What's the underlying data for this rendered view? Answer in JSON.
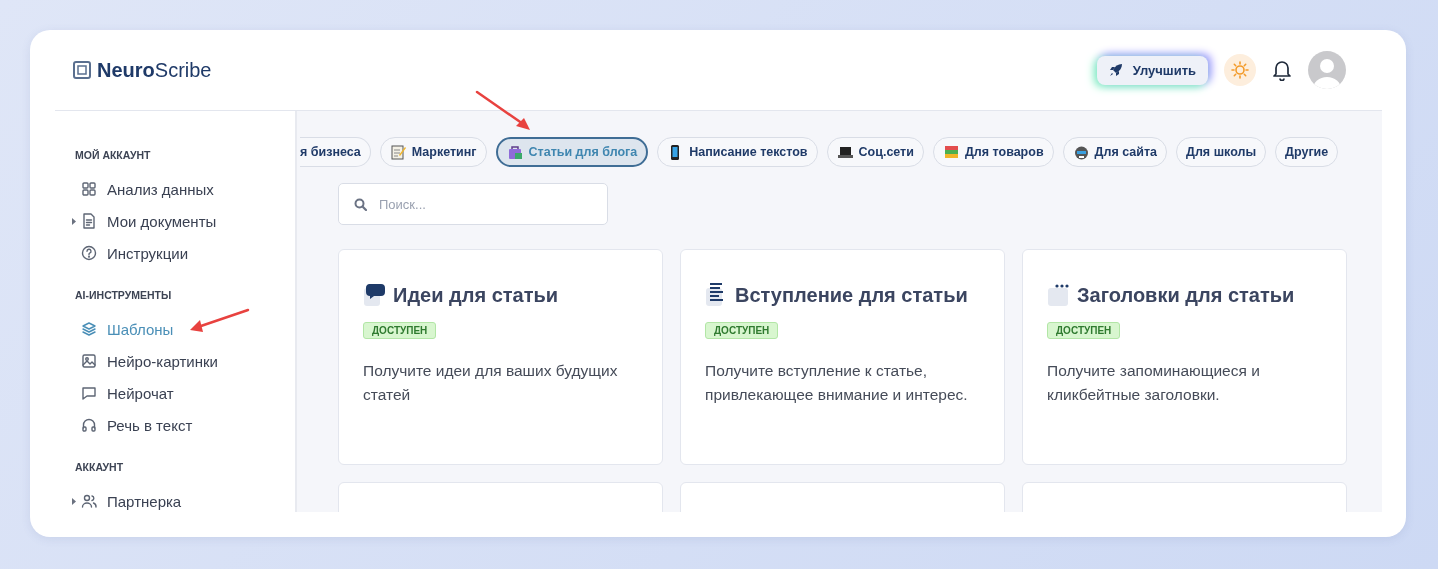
{
  "logo": {
    "text": "**Neuro**Scribe"
  },
  "header": {
    "upgrade_button": "Улучшить"
  },
  "sidebar": {
    "sections": [
      {
        "title": "МОЙ АККАУНТ",
        "items": [
          {
            "label": "Анализ данных",
            "selected": false,
            "expandable": false
          },
          {
            "label": "Мои документы",
            "selected": false,
            "expandable": true
          },
          {
            "label": "Инструкции",
            "selected": false,
            "expandable": false
          }
        ]
      },
      {
        "title": "AI-ИНСТРУМЕНТЫ",
        "items": [
          {
            "label": "Шаблоны",
            "selected": true,
            "expandable": false
          },
          {
            "label": "Нейро-картинки",
            "selected": false,
            "expandable": false
          },
          {
            "label": "Нейрочат",
            "selected": false,
            "expandable": false
          },
          {
            "label": "Речь в текст",
            "selected": false,
            "expandable": false
          }
        ]
      },
      {
        "title": "АККАУНТ",
        "items": [
          {
            "label": "Партнерка",
            "selected": false,
            "expandable": true
          }
        ]
      }
    ]
  },
  "categories": [
    {
      "label": "я бизнеса",
      "selected": false
    },
    {
      "label": "Маркетинг",
      "selected": false
    },
    {
      "label": "Статьи для блога",
      "selected": true
    },
    {
      "label": "Написание текстов",
      "selected": false
    },
    {
      "label": "Соц.сети",
      "selected": false
    },
    {
      "label": "Для товаров",
      "selected": false
    },
    {
      "label": "Для сайта",
      "selected": false
    },
    {
      "label": "Для школы",
      "selected": false
    },
    {
      "label": "Другие",
      "selected": false
    }
  ],
  "search": {
    "placeholder": "Поиск..."
  },
  "cards": [
    {
      "title": "Идеи для статьи",
      "badge": "ДОСТУПЕН",
      "description": "Получите идеи для ваших будущих статей"
    },
    {
      "title": "Вступление для статьи",
      "badge": "ДОСТУПЕН",
      "description": "Получите вступление к статье, привлекающее внимание и интерес."
    },
    {
      "title": "Заголовки для статьи",
      "badge": "ДОСТУПЕН",
      "description": "Получите запоминающиеся и кликбейтные заголовки."
    }
  ]
}
